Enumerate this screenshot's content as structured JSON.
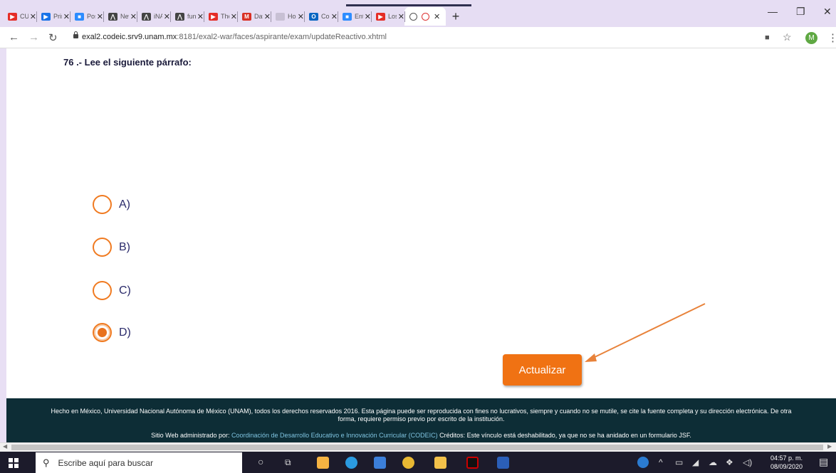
{
  "browser": {
    "tabs": [
      {
        "title": "CUR",
        "fav_color": "#e52d27",
        "fav_glyph": "▶"
      },
      {
        "title": "Prim",
        "fav_color": "#1a73e8",
        "fav_glyph": "▶"
      },
      {
        "title": "Posa",
        "fav_color": "#2d8cff",
        "fav_glyph": "■"
      },
      {
        "title": "New",
        "fav_color": "#444444",
        "fav_glyph": "⋀"
      },
      {
        "title": "iNAC",
        "fav_color": "#444444",
        "fav_glyph": "⋀"
      },
      {
        "title": "fun-",
        "fav_color": "#444444",
        "fav_glyph": "⋀"
      },
      {
        "title": "The",
        "fav_color": "#e52d27",
        "fav_glyph": "▶"
      },
      {
        "title": "Dat",
        "fav_color": "#d93025",
        "fav_glyph": "M"
      },
      {
        "title": "Hon",
        "fav_color": "#c8c0d4",
        "fav_glyph": ""
      },
      {
        "title": "Con",
        "fav_color": "#0a66c2",
        "fav_glyph": "O"
      },
      {
        "title": "Entr",
        "fav_color": "#2d8cff",
        "fav_glyph": "■"
      },
      {
        "title": "Los",
        "fav_color": "#e52d27",
        "fav_glyph": "▶"
      }
    ],
    "active_tab_title": "",
    "url_host": "exal2.codeic.srv9.unam.mx",
    "url_path": ":8181/exal2-war/faces/aspirante/exam/updateReactivo.xhtml",
    "profile_initial": "M"
  },
  "exam": {
    "question": "76 .- Lee el siguiente párrafo:",
    "options": [
      {
        "label": "A)",
        "checked": false
      },
      {
        "label": "B)",
        "checked": false
      },
      {
        "label": "C)",
        "checked": false
      },
      {
        "label": "D)",
        "checked": true
      }
    ],
    "submit_label": "Actualizar"
  },
  "footer": {
    "line1": "Hecho en México, Universidad Nacional Autónoma de México (UNAM), todos los derechos reservados 2016. Esta página puede ser reproducida con fines no lucrativos, siempre y cuando no se mutile, se cite la fuente completa y su dirección electrónica. De otra forma, requiere permiso previo por escrito de la institución.",
    "line2_prefix": "Sitio Web administrado por: ",
    "line2_link": "Coordinación de Desarrollo Educativo e Innovación Curricular (CODEIC)",
    "line2_suffix": " Créditos: Este vínculo está deshabilitado, ya que no se ha anidado en un formulario JSF."
  },
  "taskbar": {
    "search_placeholder": "Escribe aquí para buscar",
    "time": "04:57 p. m.",
    "date": "08/09/2020"
  },
  "colors": {
    "accent": "#f07213",
    "footer_bg": "#0d2d36",
    "link": "#7fc3e0"
  }
}
